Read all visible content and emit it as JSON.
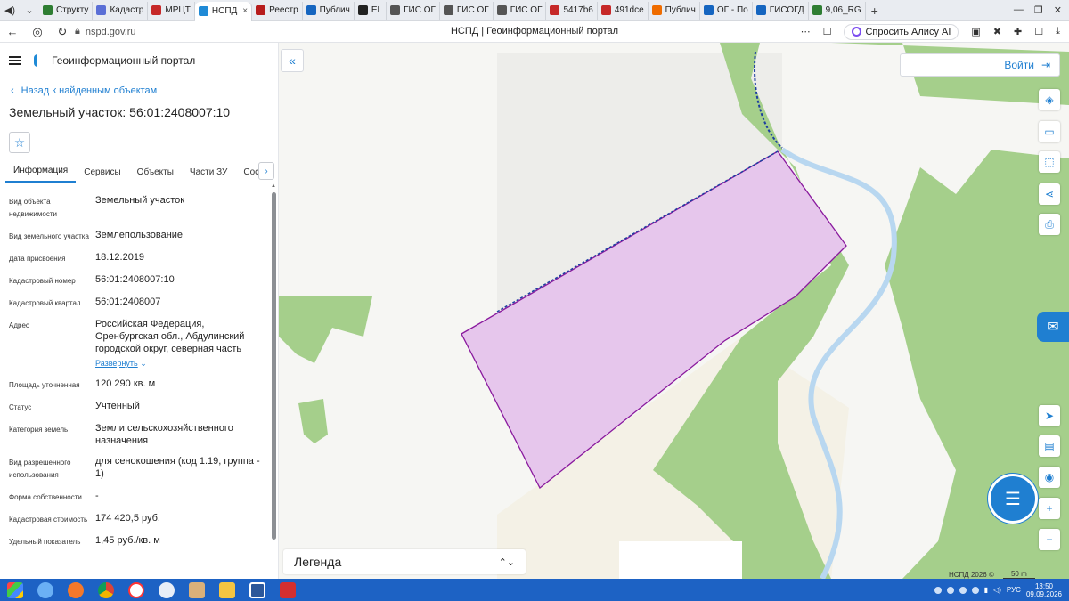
{
  "browser": {
    "tabs": [
      {
        "label": "Структу",
        "color": "#2e7d32"
      },
      {
        "label": "Кадастр",
        "color": "#5b6fd6"
      },
      {
        "label": "МРЦТ",
        "color": "#c62828"
      },
      {
        "label": "НСПД",
        "color": "#1f8ad6",
        "active": true
      },
      {
        "label": "Реестр",
        "color": "#b71c1c"
      },
      {
        "label": "Публич",
        "color": "#1565c0"
      },
      {
        "label": "EL",
        "color": "#222222"
      },
      {
        "label": "ГИС ОГ",
        "color": "#555555"
      },
      {
        "label": "ГИС ОГ",
        "color": "#555555"
      },
      {
        "label": "ГИС ОГ",
        "color": "#555555"
      },
      {
        "label": "5417b6",
        "color": "#c62828"
      },
      {
        "label": "491dce",
        "color": "#c62828"
      },
      {
        "label": "Публич",
        "color": "#ef6c00"
      },
      {
        "label": "ОГ - По",
        "color": "#1565c0"
      },
      {
        "label": "ГИСОГД",
        "color": "#1565c0"
      },
      {
        "label": "9,06_RG",
        "color": "#2e7d32"
      }
    ],
    "url": "nspd.gov.ru",
    "page_title": "НСПД | Геоинформационный портал",
    "alice_label": "Спросить Алису AI"
  },
  "panel": {
    "portal_name": "Геоинформационный портал",
    "back_link": "Назад к найденным объектам",
    "object_title": "Земельный участок: 56:01:2408007:10",
    "tabs": [
      "Информация",
      "Сервисы",
      "Объекты",
      "Части ЗУ",
      "Состав"
    ],
    "props": [
      {
        "label": "Вид объекта недвижимости",
        "value": "Земельный участок"
      },
      {
        "label": "Вид земельного участка",
        "value": "Землепользование"
      },
      {
        "label": "Дата присвоения",
        "value": "18.12.2019"
      },
      {
        "label": "Кадастровый номер",
        "value": "56:01:2408007:10"
      },
      {
        "label": "Кадастровый квартал",
        "value": "56:01:2408007"
      },
      {
        "label": "Адрес",
        "value": "Российская Федерация, Оренбургская обл., Абдулинский городской округ, северная часть"
      },
      {
        "label": "Площадь уточненная",
        "value": "120 290 кв. м"
      },
      {
        "label": "Статус",
        "value": "Учтенный"
      },
      {
        "label": "Категория земель",
        "value": "Земли сельскохозяйственного назначения"
      },
      {
        "label": "Вид разрешенного использования",
        "value": "для сенокошения (код 1.19, группа - 1)"
      },
      {
        "label": "Форма собственности",
        "value": "-"
      },
      {
        "label": "Кадастровая стоимость",
        "value": "174 420,5 руб."
      },
      {
        "label": "Удельный показатель",
        "value": "1,45 руб./кв. м"
      }
    ],
    "expand_label": "Развернуть"
  },
  "map": {
    "login_label": "Войти",
    "legend_label": "Легенда",
    "credit": "НСПД 2026 ©",
    "scale_label": "50 m",
    "parcel_fill": "#e6c6ec",
    "parcel_stroke": "#8a1a9e",
    "forest_color": "#a5cf8b",
    "river_color": "#b8d7f0"
  },
  "taskbar": {
    "lang": "РУС",
    "time": "13:50",
    "date": "09.09.2026"
  }
}
